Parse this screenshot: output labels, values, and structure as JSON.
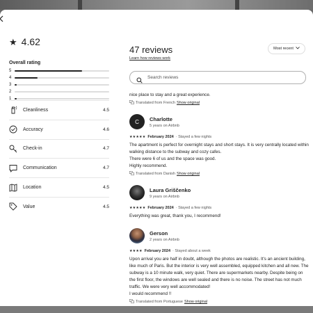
{
  "left": {
    "rating": "4.62",
    "overall_label": "Overall rating",
    "distribution": [
      {
        "stars": "5",
        "fraction": 0.71
      },
      {
        "stars": "4",
        "fraction": 0.24
      },
      {
        "stars": "3",
        "fraction": 0.02
      },
      {
        "stars": "2",
        "fraction": 0.0
      },
      {
        "stars": "1",
        "fraction": 0.02
      }
    ],
    "categories": [
      {
        "label": "Cleanliness",
        "value": "4.5",
        "icon": "spray-bottle-icon"
      },
      {
        "label": "Accuracy",
        "value": "4.6",
        "icon": "check-circle-icon"
      },
      {
        "label": "Check-in",
        "value": "4.7",
        "icon": "key-icon"
      },
      {
        "label": "Communication",
        "value": "4.7",
        "icon": "chat-bubble-icon"
      },
      {
        "label": "Location",
        "value": "4.5",
        "icon": "map-icon"
      },
      {
        "label": "Value",
        "value": "4.5",
        "icon": "tag-icon"
      }
    ]
  },
  "header": {
    "title": "47 reviews",
    "learn_link": "Learn how reviews work",
    "sort_label": "Most recent"
  },
  "search": {
    "placeholder": "Search reviews"
  },
  "fragment": {
    "text": "nice place to stay and a great experience.",
    "translated": "Translated from French",
    "show": "Show original"
  },
  "reviews": [
    {
      "name": "Charlotte",
      "initial": "C",
      "meta": "5 years on Airbnb",
      "stars": "★★★★★",
      "date": "February 2024",
      "stay": "· Stayed a few nights",
      "body": "The apartment is perfect for overnight stays and short stays. It is very centrally located within walking distance to the subway and cozy cafes.\nThere were 6 of us and the space was good.\nHighly recommend.",
      "translated": "Translated from Danish",
      "show": "Show original"
    },
    {
      "name": "Laura Griščenko",
      "initial": "",
      "meta": "9 years on Airbnb",
      "stars": "★★★★★",
      "date": "February 2024",
      "stay": "· Stayed a few nights",
      "body": "Everything was great, thank you, I recommend!",
      "translated": "",
      "show": ""
    },
    {
      "name": "Gerson",
      "initial": "",
      "meta": "2 years on Airbnb",
      "stars": "★★★★",
      "date": "February 2024",
      "stay": "· Stayed about a week",
      "body": "Upon arrival you are half in doubt, although the photos are realistic. It's an ancient building, like much of Paris. But the interior is very well assembled, equipped kitchen and all new. The subway is a 10 minute walk, very quiet. There are supermarkets nearby. Despite being on the first floor, the windows are well sealed and there is no noise. The street has not much traffic. We were very well accommodated!\nI would recommend !!",
      "translated": "Translated from Portuguese",
      "show": "Show original"
    }
  ],
  "colors": {
    "accent": "#222222",
    "muted": "#555555",
    "divider": "#e5e5e5"
  }
}
